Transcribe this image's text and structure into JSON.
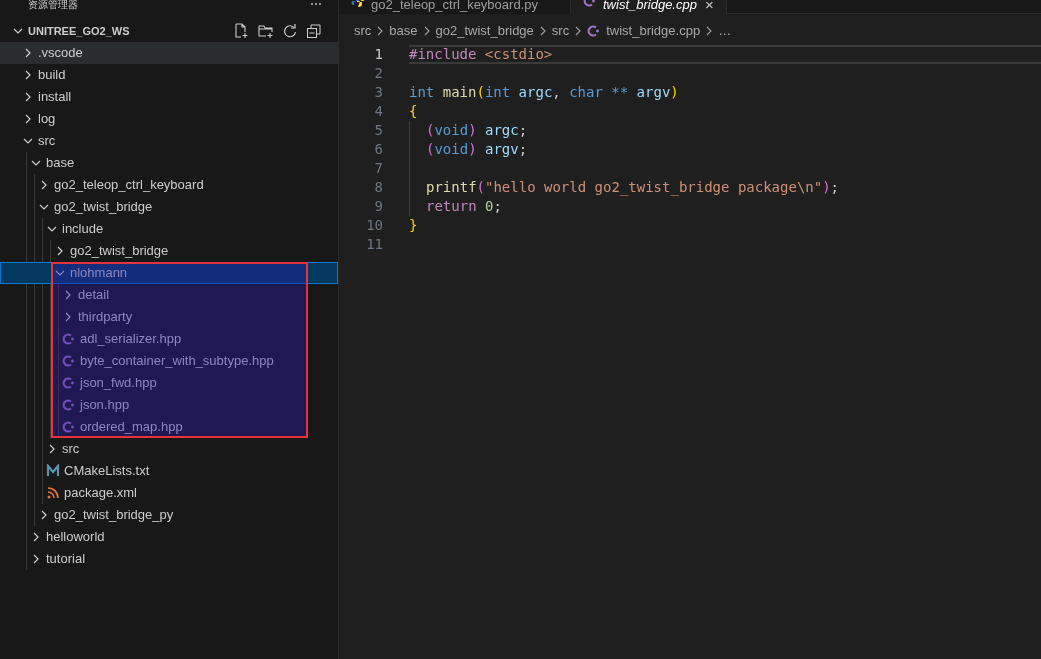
{
  "sidebar": {
    "title": "资源管理器",
    "more": "⋯",
    "workspace": {
      "title": "UNITREE_GO2_WS",
      "expanded": true
    },
    "items": [
      {
        "label": ".vscode",
        "kind": "folder",
        "expanded": false,
        "selected": false,
        "hovered": true
      },
      {
        "label": "build",
        "kind": "folder",
        "expanded": false,
        "selected": false,
        "hovered": false
      },
      {
        "label": "install",
        "kind": "folder",
        "expanded": false,
        "selected": false,
        "hovered": false
      },
      {
        "label": "log",
        "kind": "folder",
        "expanded": false,
        "selected": false,
        "hovered": false
      },
      {
        "label": "src",
        "kind": "folder",
        "expanded": true,
        "selected": false,
        "hovered": false,
        "children": [
          {
            "label": "base",
            "kind": "folder",
            "expanded": true,
            "selected": false,
            "hovered": false,
            "children": [
              {
                "label": "go2_teleop_ctrl_keyboard",
                "kind": "folder",
                "expanded": false,
                "selected": false,
                "hovered": false
              },
              {
                "label": "go2_twist_bridge",
                "kind": "folder",
                "expanded": true,
                "selected": false,
                "hovered": false,
                "children": [
                  {
                    "label": "include",
                    "kind": "folder",
                    "expanded": true,
                    "selected": false,
                    "hovered": false,
                    "children": [
                      {
                        "label": "go2_twist_bridge",
                        "kind": "folder",
                        "expanded": false,
                        "selected": false,
                        "hovered": false
                      },
                      {
                        "label": "nlohmann",
                        "kind": "folder",
                        "expanded": true,
                        "selected": true,
                        "hovered": false,
                        "annotated": true,
                        "children": [
                          {
                            "label": "detail",
                            "kind": "folder",
                            "expanded": false,
                            "selected": false,
                            "hovered": false
                          },
                          {
                            "label": "thirdparty",
                            "kind": "folder",
                            "expanded": false,
                            "selected": false,
                            "hovered": false
                          },
                          {
                            "label": "adl_serializer.hpp",
                            "kind": "cpp",
                            "selected": false,
                            "hovered": false
                          },
                          {
                            "label": "byte_container_with_subtype.hpp",
                            "kind": "cpp",
                            "selected": false,
                            "hovered": false
                          },
                          {
                            "label": "json_fwd.hpp",
                            "kind": "cpp",
                            "selected": false,
                            "hovered": false
                          },
                          {
                            "label": "json.hpp",
                            "kind": "cpp",
                            "selected": false,
                            "hovered": false
                          },
                          {
                            "label": "ordered_map.hpp",
                            "kind": "cpp",
                            "selected": false,
                            "hovered": false
                          }
                        ]
                      }
                    ]
                  },
                  {
                    "label": "src",
                    "kind": "folder",
                    "expanded": false,
                    "selected": false,
                    "hovered": false
                  },
                  {
                    "label": "CMakeLists.txt",
                    "kind": "cmake",
                    "selected": false,
                    "hovered": false
                  },
                  {
                    "label": "package.xml",
                    "kind": "xml",
                    "selected": false,
                    "hovered": false
                  }
                ]
              },
              {
                "label": "go2_twist_bridge_py",
                "kind": "folder",
                "expanded": false,
                "selected": false,
                "hovered": false
              }
            ]
          },
          {
            "label": "helloworld",
            "kind": "folder",
            "expanded": false,
            "selected": false,
            "hovered": false
          },
          {
            "label": "tutorial",
            "kind": "folder",
            "expanded": false,
            "selected": false,
            "hovered": false
          }
        ]
      }
    ]
  },
  "tabs": [
    {
      "label": "go2_teleop_ctrl_keyboard.py",
      "kind": "python",
      "selected": false,
      "preview": false
    },
    {
      "label": "twist_bridge.cpp",
      "kind": "cpp",
      "selected": true,
      "preview": true,
      "close": "×"
    }
  ],
  "breadcrumb": [
    {
      "label": "src",
      "kind": "folder"
    },
    {
      "label": "base",
      "kind": "folder"
    },
    {
      "label": "go2_twist_bridge",
      "kind": "folder"
    },
    {
      "label": "src",
      "kind": "folder"
    },
    {
      "label": "twist_bridge.cpp",
      "kind": "cpp"
    },
    {
      "label": "…",
      "kind": "more"
    }
  ],
  "editor": {
    "lines": [
      {
        "number": "1",
        "current": true,
        "tokens": [
          {
            "text": "#include ",
            "kind": "preproc"
          },
          {
            "text": "<cstdio>",
            "kind": "string"
          }
        ]
      },
      {
        "number": "2",
        "current": false
      },
      {
        "number": "3",
        "current": false,
        "tokens": [
          {
            "text": "int ",
            "kind": "keyword"
          },
          {
            "text": "main",
            "kind": "function"
          },
          {
            "text": "(",
            "kind": "bracket1"
          },
          {
            "text": "int ",
            "kind": "keyword"
          },
          {
            "text": "argc",
            "kind": "variable"
          },
          {
            "text": ", ",
            "kind": "plain"
          },
          {
            "text": "char ** ",
            "kind": "keyword"
          },
          {
            "text": "argv",
            "kind": "variable"
          },
          {
            "text": ")",
            "kind": "bracket1"
          }
        ]
      },
      {
        "number": "4",
        "current": false,
        "tokens": [
          {
            "text": "{",
            "kind": "bracket1"
          }
        ]
      },
      {
        "number": "5",
        "current": false,
        "indent": true,
        "tokens": [
          {
            "text": "(",
            "kind": "bracket2"
          },
          {
            "text": "void",
            "kind": "keyword"
          },
          {
            "text": ") ",
            "kind": "bracket2"
          },
          {
            "text": "argc",
            "kind": "variable"
          },
          {
            "text": ";",
            "kind": "plain"
          }
        ]
      },
      {
        "number": "6",
        "current": false,
        "indent": true,
        "tokens": [
          {
            "text": "(",
            "kind": "bracket2"
          },
          {
            "text": "void",
            "kind": "keyword"
          },
          {
            "text": ") ",
            "kind": "bracket2"
          },
          {
            "text": "argv",
            "kind": "variable"
          },
          {
            "text": ";",
            "kind": "plain"
          }
        ]
      },
      {
        "number": "7",
        "current": false,
        "indent": true
      },
      {
        "number": "8",
        "current": false,
        "indent": true,
        "tokens": [
          {
            "text": "printf",
            "kind": "function"
          },
          {
            "text": "(",
            "kind": "bracket2"
          },
          {
            "text": "\"hello world go2_twist_bridge package\\n\"",
            "kind": "string"
          },
          {
            "text": ")",
            "kind": "bracket2"
          },
          {
            "text": ";",
            "kind": "plain"
          }
        ]
      },
      {
        "number": "9",
        "current": false,
        "indent": true,
        "tokens": [
          {
            "text": "return ",
            "kind": "control"
          },
          {
            "text": "0",
            "kind": "number"
          },
          {
            "text": ";",
            "kind": "plain"
          }
        ]
      },
      {
        "number": "10",
        "current": false,
        "tokens": [
          {
            "text": "}",
            "kind": "bracket1"
          }
        ]
      },
      {
        "number": "11",
        "current": false
      }
    ]
  }
}
